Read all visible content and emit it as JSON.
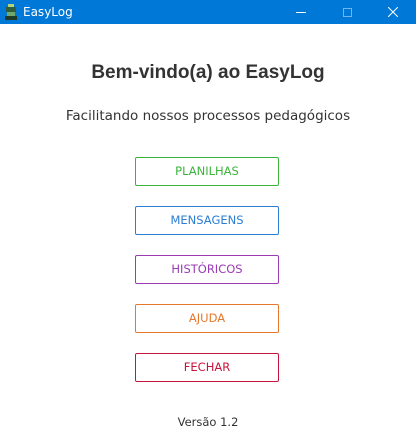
{
  "window": {
    "title": "EasyLog"
  },
  "main": {
    "heading": "Bem-vindo(a) ao EasyLog",
    "subheading": "Facilitando nossos processos pedagógicos",
    "version": "Versão 1.2"
  },
  "buttons": [
    {
      "label": "PLANILHAS",
      "color": "#3cb43c"
    },
    {
      "label": "MENSAGENS",
      "color": "#2d7dd2"
    },
    {
      "label": "HISTÓRICOS",
      "color": "#9b3cb4"
    },
    {
      "label": "AJUDA",
      "color": "#e6782d"
    },
    {
      "label": "FECHAR",
      "color": "#c8143c"
    }
  ],
  "colors": {
    "titlebar": "#0078d7",
    "text": "#333333"
  }
}
